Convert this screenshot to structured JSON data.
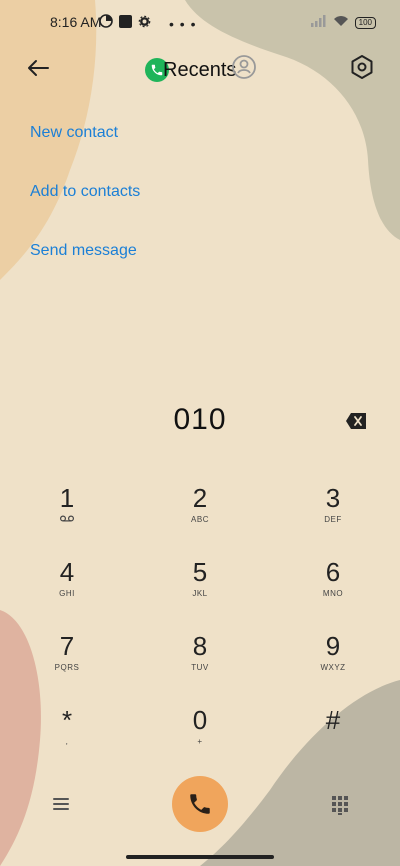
{
  "status": {
    "time": "8:16 AM",
    "battery": "100"
  },
  "header": {
    "title": "Recents"
  },
  "actions": [
    "New contact",
    "Add to contacts",
    "Send message"
  ],
  "dialed_number": "010",
  "keypad": [
    {
      "digit": "1",
      "sub": "voicemail-icon"
    },
    {
      "digit": "2",
      "sub": "ABC"
    },
    {
      "digit": "3",
      "sub": "DEF"
    },
    {
      "digit": "4",
      "sub": "GHI"
    },
    {
      "digit": "5",
      "sub": "JKL"
    },
    {
      "digit": "6",
      "sub": "MNO"
    },
    {
      "digit": "7",
      "sub": "PQRS"
    },
    {
      "digit": "8",
      "sub": "TUV"
    },
    {
      "digit": "9",
      "sub": "WXYZ"
    },
    {
      "digit": "*",
      "sub": ","
    },
    {
      "digit": "0",
      "sub": "+"
    },
    {
      "digit": "#",
      "sub": ""
    }
  ],
  "colors": {
    "accent_link": "#1b7fd6",
    "call_button": "#f0a55c",
    "recents_badge": "#1fb45a"
  }
}
